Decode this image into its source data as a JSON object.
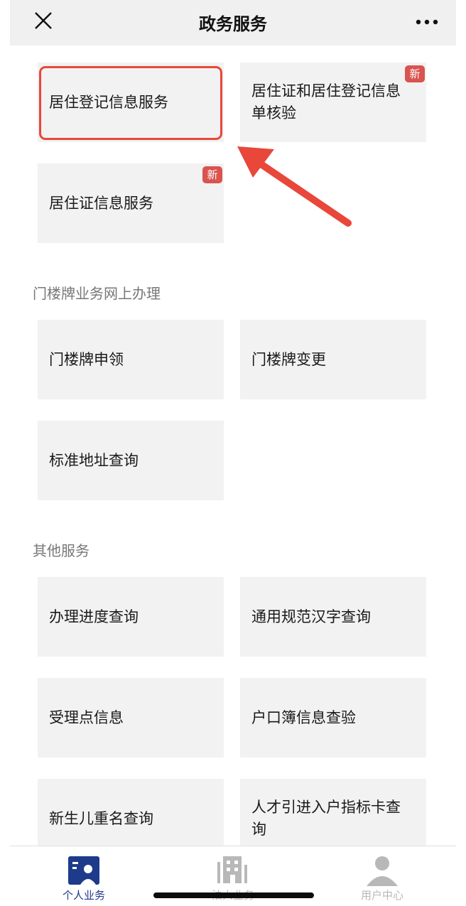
{
  "header": {
    "title": "政务服务"
  },
  "residence": {
    "tiles": [
      {
        "label": "居住登记信息服务",
        "badge": ""
      },
      {
        "label": "居住证和居住登记信息单核验",
        "badge": "新"
      },
      {
        "label": "居住证信息服务",
        "badge": "新"
      }
    ]
  },
  "house_number": {
    "title": "门楼牌业务网上办理",
    "tiles": [
      {
        "label": "门楼牌申领"
      },
      {
        "label": "门楼牌变更"
      },
      {
        "label": "标准地址查询"
      }
    ]
  },
  "other": {
    "title": "其他服务",
    "tiles": [
      {
        "label": "办理进度查询"
      },
      {
        "label": "通用规范汉字查询"
      },
      {
        "label": "受理点信息"
      },
      {
        "label": "户口簿信息查验"
      },
      {
        "label": "新生儿重名查询"
      },
      {
        "label": "人才引进入户指标卡查询"
      }
    ]
  },
  "tabbar": {
    "tabs": [
      {
        "label": "个人业务",
        "icon": "person-card-icon",
        "active": true
      },
      {
        "label": "法人业务",
        "icon": "building-icon",
        "active": false
      },
      {
        "label": "用户中心",
        "icon": "user-icon",
        "active": false
      }
    ]
  },
  "colors": {
    "highlight": "#e8473a",
    "badge": "#d9534f",
    "tab_active": "#1e3a8a",
    "tab_inactive": "#b8b8b8"
  }
}
